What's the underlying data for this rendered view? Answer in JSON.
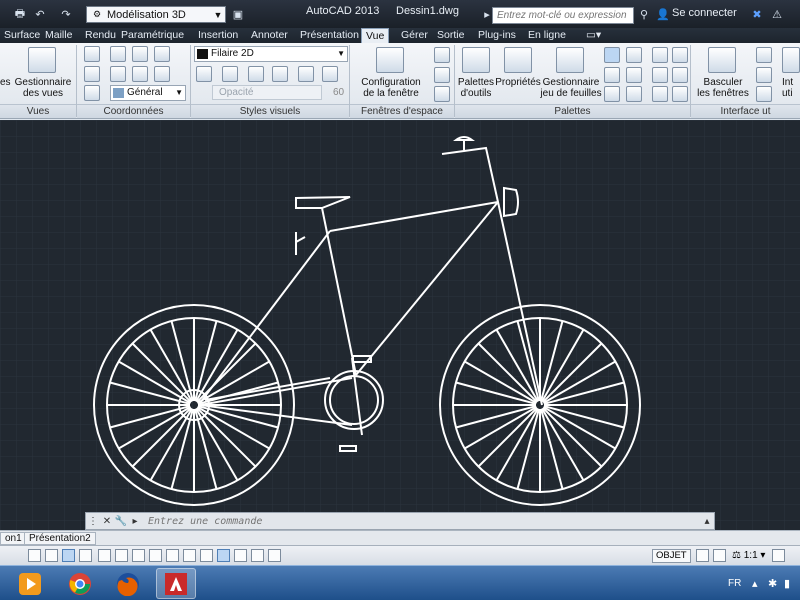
{
  "titlebar": {
    "workspace": "Modélisation 3D",
    "app_name": "AutoCAD 2013",
    "document": "Dessin1.dwg",
    "search_placeholder": "Entrez mot-clé ou expression",
    "sign_in": "Se connecter"
  },
  "tabs": [
    {
      "label": "Surface"
    },
    {
      "label": "Maille"
    },
    {
      "label": "Rendu"
    },
    {
      "label": "Paramétrique"
    },
    {
      "label": "Insertion"
    },
    {
      "label": "Annoter"
    },
    {
      "label": "Présentation"
    },
    {
      "label": "Vue"
    },
    {
      "label": "Gérer"
    },
    {
      "label": "Sortie"
    },
    {
      "label": "Plug-ins"
    },
    {
      "label": "En ligne"
    }
  ],
  "active_tab": "Vue",
  "ribbon": {
    "vues": {
      "truncated_label": "es",
      "manager_line1": "Gestionnaire",
      "manager_line2": "des vues",
      "title": "Vues"
    },
    "coordonnees": {
      "ucs_combo": "Général",
      "title": "Coordonnées"
    },
    "styles_visuels": {
      "style_combo": "Filaire 2D",
      "opacity_label": "Opacité",
      "opacity_value": "60",
      "title": "Styles visuels"
    },
    "fenetres": {
      "config_line1": "Configuration",
      "config_line2": "de la fenêtre",
      "title": "Fenêtres d'espace objet"
    },
    "palettes": {
      "tool_line1": "Palettes",
      "tool_line2": "d'outils",
      "props": "Propriétés",
      "sheet_line1": "Gestionnaire",
      "sheet_line2": "jeu de feuilles",
      "title": "Palettes"
    },
    "interface": {
      "switch_line1": "Basculer",
      "switch_line2": "les fenêtres",
      "cut_line1": "Int",
      "cut_line2": "uti",
      "title": "Interface ut"
    }
  },
  "command_line": {
    "placeholder": "Entrez une commande"
  },
  "layout_tabs": [
    {
      "label": "on1"
    },
    {
      "label": "Présentation2"
    }
  ],
  "statusbar": {
    "objet": "OBJET",
    "scale": "1:1"
  },
  "taskbar": {
    "lang": "FR"
  },
  "colors": {
    "canvas_bg": "#212830",
    "drawing_stroke": "#ffffff",
    "ribbon_bg": "#e6ebf1",
    "titlebar_bg": "#222a34",
    "taskbar_bg": "#2d5f9c"
  }
}
